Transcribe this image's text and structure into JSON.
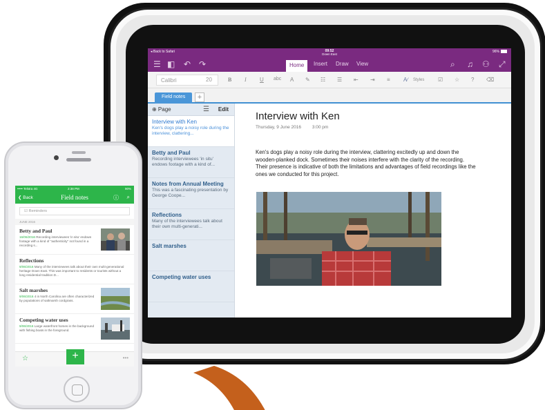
{
  "tablet": {
    "status": {
      "back": "◂ Back to Safari",
      "time": "09:52",
      "doc": "Down East",
      "battery": "96%"
    },
    "ribbon_tabs": [
      "Home",
      "Insert",
      "Draw",
      "View"
    ],
    "toolbar": {
      "font": "Calibri",
      "size": "20",
      "bold": "B",
      "italic": "I",
      "underline": "U",
      "strike": "abc",
      "styles": "Styles"
    },
    "section_tab": "Field notes",
    "pagelist": {
      "add_page": "⊕ Page",
      "edit": "Edit",
      "pages": [
        {
          "title": "Interview with Ken",
          "preview": "Ken's dogs play a noisy role during the interview, clattering...",
          "selected": true
        },
        {
          "title": "Betty and Paul",
          "preview": "Recording interviewees 'in situ' endows footage with a kind of...",
          "selected": false
        },
        {
          "title": "Notes from Annual Meeting",
          "preview": "This was a fascinating presentation by George Coope...",
          "selected": false
        },
        {
          "title": "Reflections",
          "preview": "Many of the interviewees talk about their own multi-generati...",
          "selected": false
        },
        {
          "title": "Salt marshes",
          "preview": "",
          "selected": false
        },
        {
          "title": "Competing water uses",
          "preview": "",
          "selected": false
        }
      ]
    },
    "note": {
      "title": "Interview with Ken",
      "date": "Thursday, 9 June 2016",
      "time": "3:00 pm",
      "body": "Ken's dogs play a noisy role during the interview, clattering excitedly up and down the wooden-planked dock. Sometimes their noises interfere with the clarity of the recording. Their presence is indicative of both the limitations and advantages of field recordings like the ones we conducted for this project."
    }
  },
  "phone": {
    "status": {
      "carrier": "••••• Telstra 4G",
      "time": "2:38 PM",
      "battery": "90%"
    },
    "nav": {
      "back": "❮ Back",
      "title": "Field notes"
    },
    "reminders": "Reminders",
    "section": "JUNE 2016",
    "notes": [
      {
        "title": "Betty and Paul",
        "date": "16/06/2016",
        "body": "Recording interviewees 'in situ' endows footage with a kind of \"authenticity\" not found in a recording s..."
      },
      {
        "title": "Reflections",
        "date": "9/06/2016",
        "body": "Many of the interviewees talk about their own multi-generational heritage Down East. This was important to residents or tourists without a long residential tradition D..."
      },
      {
        "title": "Salt marshes",
        "date": "9/06/2016",
        "body": "4 in North Carolina are often characterized by populations of saltmarsh cordgrass."
      },
      {
        "title": "Competing water uses",
        "date": "9/06/2016",
        "body": "Large waterfront homes in the background with fishing boats in the foreground."
      }
    ]
  }
}
